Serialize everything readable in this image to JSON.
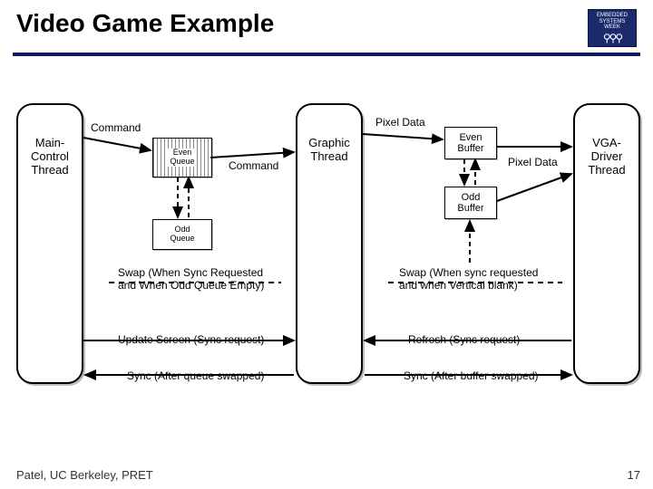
{
  "header": {
    "title": "Video Game Example",
    "logo_line1": "EMBEDDED",
    "logo_line2": "SYSTEMS",
    "logo_line3": "WEEK"
  },
  "threads": {
    "main": "Main-\nControl\nThread",
    "graphic": "Graphic\nThread",
    "vga": "VGA-\nDriver\nThread"
  },
  "queues": {
    "even": "Even\nQueue",
    "odd": "Odd\nQueue"
  },
  "buffers": {
    "even": "Even\nBuffer",
    "odd": "Odd\nBuffer"
  },
  "labels": {
    "command_top": "Command",
    "command_mid": "Command",
    "pixel_data_top": "Pixel Data",
    "pixel_data_right": "Pixel Data",
    "swap_left": "Swap (When Sync Requested and When Odd Queue Empty)",
    "swap_right": "Swap (When sync requested and when Vertical blank)",
    "update": "Update Screen (Sync request)",
    "refresh": "Refresh (Sync request)",
    "sync_left": "Sync (After queue swapped)",
    "sync_right": "Sync (After buffer swapped)"
  },
  "footer": {
    "text": "Patel, UC Berkeley, PRET",
    "page": "17"
  }
}
